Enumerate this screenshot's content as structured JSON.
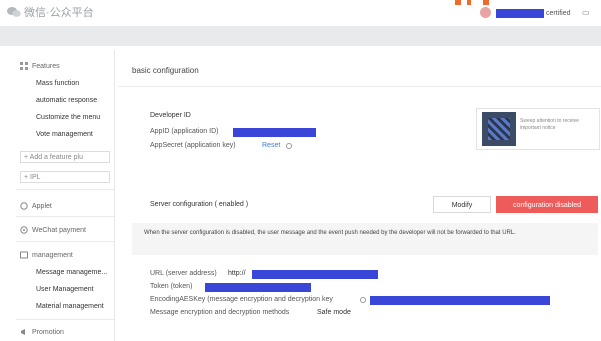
{
  "header": {
    "logo_text": "微信·公众平台",
    "certified_label": "certified",
    "colors": {
      "redaction": "#3a46d8",
      "accent_red": "#ee5b5b",
      "link_blue": "#3c7bd6"
    }
  },
  "sidebar": {
    "features_label": "Features",
    "feature_items": [
      "Mass function",
      "automatic response",
      "Customize the menu",
      "Vote management"
    ],
    "add_feature_label": "+ Add a feature plu",
    "plugin_label": "+ IPL",
    "applet_label": "Applet",
    "wechat_payment_label": "WeChat payment",
    "management_label": "management",
    "management_items": [
      "Message manageme...",
      "User Management",
      "Material management"
    ],
    "promotion_label": "Promotion"
  },
  "main": {
    "page_title": "basic configuration",
    "developer_id_label": "Developer ID",
    "appid_label": "AppID (application ID)",
    "appsecret_label": "AppSecret (application key)",
    "reset_label": "Reset",
    "qr_text": "Sweep attention to receive important notice",
    "server_config_label": "Server configuration ( enabled )",
    "modify_button": "Modify",
    "config_disabled_button": "configuration disabled",
    "notice_text": "When the server configuration is disabled, the user message and the event push needed by the developer will not be forwarded to that URL.",
    "url_label": "URL (server address)",
    "url_value": "http://",
    "token_label": "Token (token)",
    "aeskey_label": "EncodingAESKey (message encryption and decryption key",
    "encryption_method_label": "Message encryption and decryption methods",
    "encryption_method_value": "Safe mode"
  }
}
